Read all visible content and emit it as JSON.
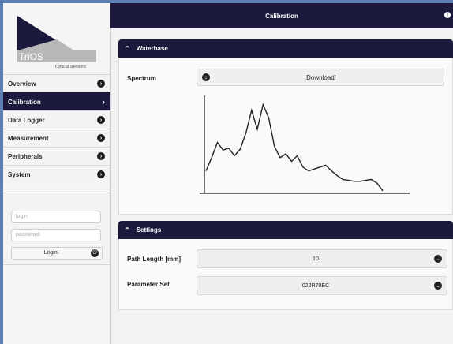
{
  "app": {
    "title": "Calibration",
    "info_icon": "info-icon"
  },
  "logo": {
    "name": "TriOS",
    "tagline": "Optical Sensors"
  },
  "sidebar": {
    "items": [
      {
        "label": "Overview",
        "icon": "chevron-right-circle-icon",
        "active": false
      },
      {
        "label": "Calibration",
        "icon": "chevron-right-icon",
        "active": true
      },
      {
        "label": "Data Logger",
        "icon": "chevron-right-circle-icon",
        "active": false
      },
      {
        "label": "Measurement",
        "icon": "chevron-right-circle-icon",
        "active": false
      },
      {
        "label": "Peripherals",
        "icon": "chevron-right-circle-icon",
        "active": false
      },
      {
        "label": "System",
        "icon": "chevron-right-circle-icon",
        "active": false
      }
    ]
  },
  "login": {
    "login_placeholder": "login",
    "password_placeholder": "password",
    "button_label": "Login!",
    "button_icon": "power-icon"
  },
  "waterbase": {
    "title": "Waterbase",
    "spectrum_label": "Spectrum",
    "download_label": "Download!",
    "download_icon": "download-icon"
  },
  "chart_data": {
    "type": "line",
    "title": "",
    "xlabel": "",
    "ylabel": "",
    "grid": false,
    "series": [
      {
        "values": [
          0.22,
          0.36,
          0.52,
          0.44,
          0.46,
          0.38,
          0.45,
          0.62,
          0.86,
          0.66,
          0.92,
          0.78,
          0.48,
          0.36,
          0.4,
          0.32,
          0.38,
          0.26,
          0.22,
          0.24,
          0.26,
          0.28,
          0.22,
          0.17,
          0.13,
          0.12,
          0.11,
          0.11,
          0.12,
          0.13,
          0.09,
          0.01
        ]
      }
    ]
  },
  "settings": {
    "title": "Settings",
    "path_length_label": "Path Length [mm]",
    "path_length_value": "10",
    "parameter_set_label": "Parameter Set",
    "parameter_set_value": "022R70EC"
  },
  "colors": {
    "header_bg": "#1b1a3c",
    "page_border": "#5a7fb3"
  }
}
